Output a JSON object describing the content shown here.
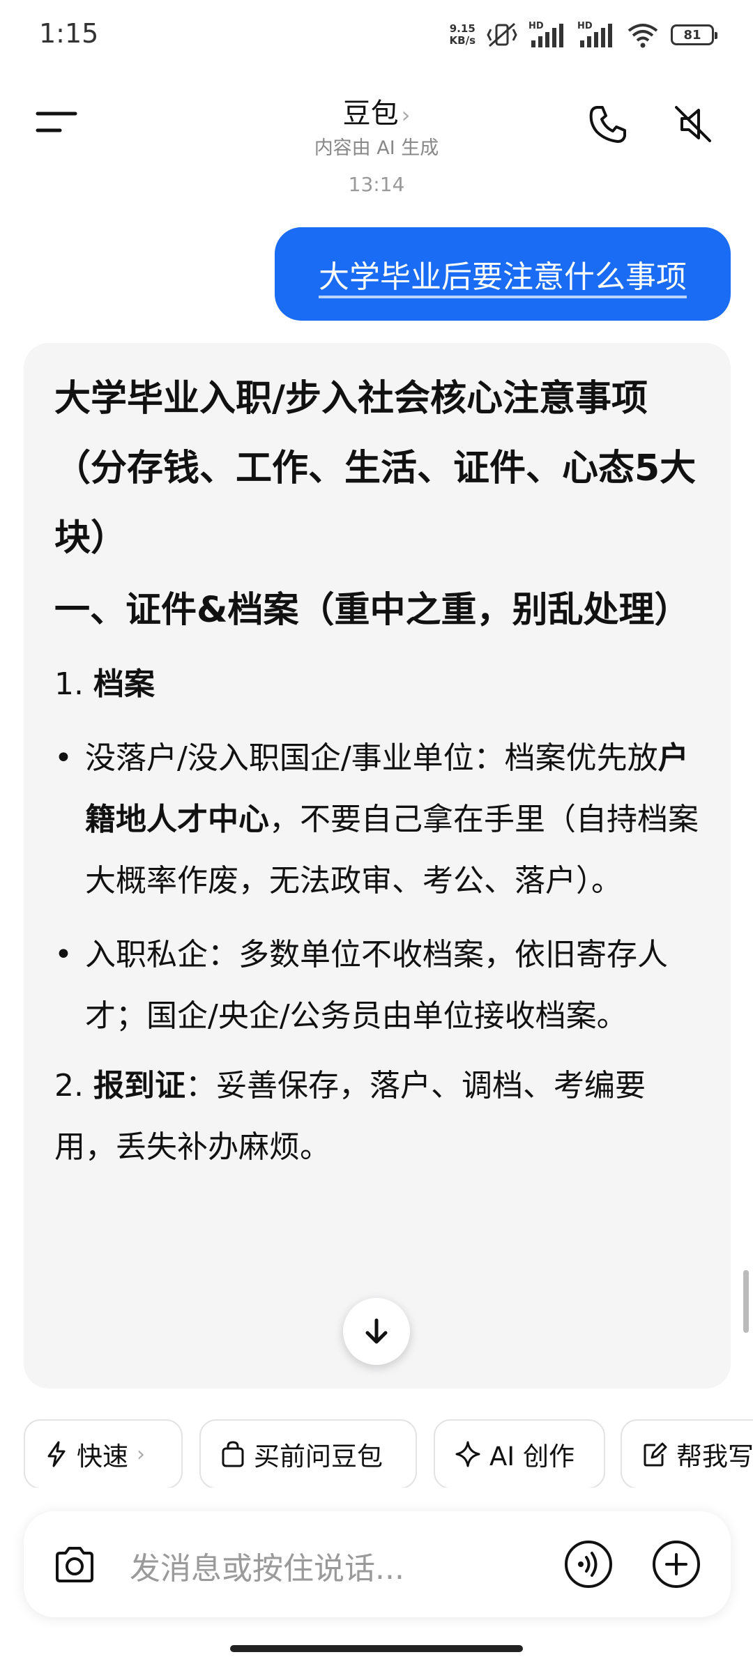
{
  "status_bar": {
    "time": "1:15",
    "net_speed_value": "9.15",
    "net_speed_unit": "KB/s",
    "signal1_label": "HD",
    "signal2_label": "HD",
    "battery": "81"
  },
  "header": {
    "title": "豆包",
    "title_chevron": "›",
    "subtitle": "内容由 AI 生成",
    "icons": [
      "menu-icon",
      "phone-icon",
      "speaker-muted-icon"
    ]
  },
  "conversation": {
    "timestamp": "13:14",
    "user_message": "大学毕业后要注意什么事项",
    "answer": {
      "title": "大学毕业入职/步入社会核心注意事项（分存钱、工作、生活、证件、心态5大块）",
      "section1_heading": "一、证件&档案（重中之重，别乱处理）",
      "item1_number": "1.",
      "item1_title": "档案",
      "bullet1_pre": "没落户/没入职国企/事业单位：档案优先放",
      "bullet1_bold": "户籍地人才中心",
      "bullet1_post": "，不要自己拿在手里（自持档案大概率作废，无法政审、考公、落户）。",
      "bullet2": "入职私企：多数单位不收档案，依旧寄存人才；国企/央企/公务员由单位接收档案。",
      "item2_number": "2.",
      "item2_title": "报到证",
      "item2_text": "：妥善保存，落户、调档、考编要用，丢失补办麻烦。"
    }
  },
  "chips": [
    {
      "label": "快速",
      "icon": "lightning-icon",
      "chevron": "›"
    },
    {
      "label": "买前问豆包",
      "icon": "shopping-bag-icon"
    },
    {
      "label": "AI 创作",
      "icon": "sparkle-icon"
    },
    {
      "label": "帮我写",
      "icon": "edit-icon"
    }
  ],
  "input": {
    "placeholder": "发消息或按住说话..."
  },
  "colors": {
    "accent": "#1a6cf5",
    "card_bg": "#f5f5f6"
  }
}
